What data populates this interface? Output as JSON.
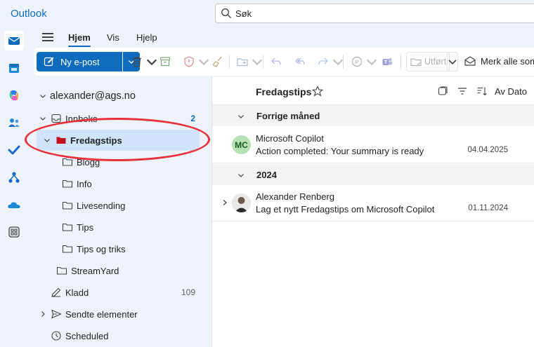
{
  "app": {
    "title": "Outlook"
  },
  "search": {
    "placeholder": "Søk"
  },
  "rail": [
    {
      "icon": "mail-icon",
      "active": true
    },
    {
      "icon": "calendar-icon"
    },
    {
      "icon": "copilot-icon"
    },
    {
      "icon": "people-icon"
    },
    {
      "icon": "todo-check-icon"
    },
    {
      "icon": "org-chart-icon"
    },
    {
      "icon": "onedrive-cloud-icon"
    },
    {
      "icon": "apps-grid-icon"
    }
  ],
  "ribbon": {
    "tabs": [
      "Hjem",
      "Vis",
      "Hjelp"
    ],
    "active_tab": "Hjem"
  },
  "toolbar": {
    "new_mail_label": "Ny e-post",
    "move_label": "Utført",
    "mark_all_label": "Merk alle som"
  },
  "folders": {
    "account": "alexander@ags.no",
    "items": [
      {
        "label": "Innboks",
        "count": "2"
      },
      {
        "label": "Fredagstips",
        "selected": true
      },
      {
        "label": "Blogg"
      },
      {
        "label": "Info"
      },
      {
        "label": "Livesending"
      },
      {
        "label": "Tips"
      },
      {
        "label": "Tips og triks"
      },
      {
        "label": "StreamYard"
      },
      {
        "label": "Kladd",
        "count": "109"
      },
      {
        "label": "Sendte elementer"
      },
      {
        "label": "Scheduled"
      }
    ]
  },
  "message_list": {
    "title": "Fredagstips",
    "sort_label": "Av Dato",
    "groups": [
      {
        "label": "Forrige måned",
        "messages": [
          {
            "initials": "MC",
            "sender": "Microsoft Copilot",
            "subject": "Action completed: Your summary is ready",
            "date": "04.04.2025"
          }
        ]
      },
      {
        "label": "2024",
        "messages": [
          {
            "initials": "",
            "sender": "Alexander Renberg",
            "subject": "Lag et nytt Fredagstips om Microsoft Copilot",
            "date": "01.11.2024"
          }
        ]
      }
    ]
  },
  "colors": {
    "accent": "#0f6cbd",
    "selection": "#cfe4fa",
    "highlight_ring": "#e8313c",
    "folder_red": "#c50f1f"
  }
}
